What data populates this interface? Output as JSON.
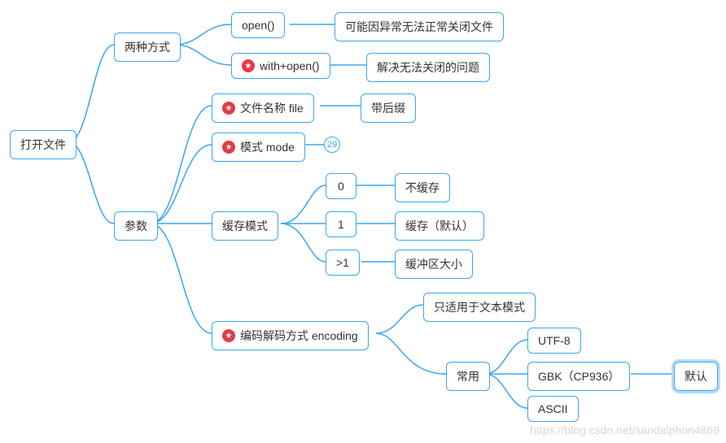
{
  "root": "打开文件",
  "methods": {
    "label": "两种方式",
    "open": {
      "label": "open()",
      "note": "可能因异常无法正常关闭文件"
    },
    "withopen": {
      "label": "with+open()",
      "note": "解决无法关闭的问题",
      "starred": true
    }
  },
  "params": {
    "label": "参数",
    "file": {
      "label": "文件名称 file",
      "note": "带后缀",
      "starred": true
    },
    "mode": {
      "label": "模式 mode",
      "badge": "29",
      "starred": true
    },
    "buffer": {
      "label": "缓存模式",
      "opts": [
        {
          "val": "0",
          "desc": "不缓存"
        },
        {
          "val": "1",
          "desc": "缓存（默认）"
        },
        {
          "val": ">1",
          "desc": "缓冲区大小"
        }
      ]
    },
    "encoding": {
      "label": "编码解码方式 encoding",
      "starred": true,
      "note1": "只适用于文本模式",
      "common": {
        "label": "常用",
        "list": [
          "UTF-8",
          "GBK（CP936）",
          "ASCII"
        ],
        "default": "默认"
      }
    }
  },
  "watermark": "https://blog.csdn.net/sandalphon4869"
}
